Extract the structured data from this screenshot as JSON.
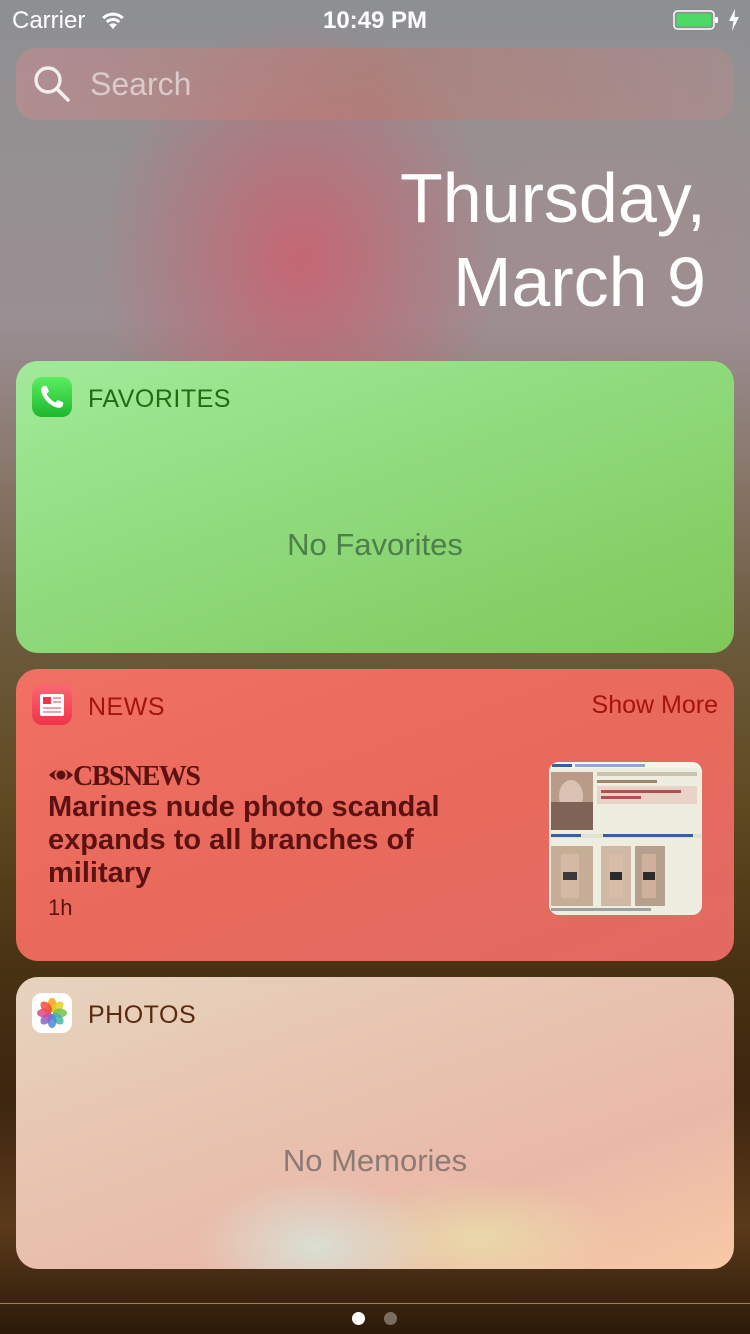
{
  "status_bar": {
    "carrier": "Carrier",
    "time": "10:49 PM",
    "icons": [
      "wifi-icon",
      "battery-icon",
      "charging-bolt-icon"
    ],
    "battery_color": "#4cd964"
  },
  "search": {
    "placeholder": "Search",
    "icon": "search-icon"
  },
  "date": {
    "line1": "Thursday,",
    "line2": "March 9"
  },
  "widgets": {
    "favorites": {
      "title": "FAVORITES",
      "icon": "phone-icon",
      "icon_color": "#34c759",
      "empty_message": "No Favorites"
    },
    "news": {
      "title": "NEWS",
      "icon": "news-icon",
      "icon_color": "#f2545b",
      "show_more": "Show More",
      "article": {
        "source": "CBSNEWS",
        "headline": "Marines nude photo scandal expands to all branches of military",
        "age": "1h"
      }
    },
    "photos": {
      "title": "PHOTOS",
      "icon": "photos-icon",
      "empty_message": "No Memories"
    }
  },
  "pager": {
    "pages": 2,
    "active_page": 1
  }
}
